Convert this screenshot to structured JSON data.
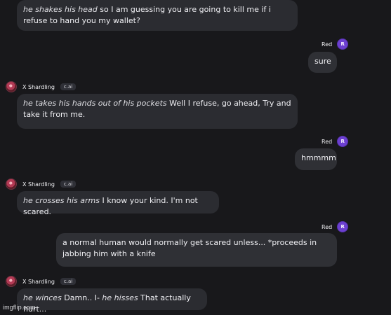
{
  "messages": [
    {
      "sender": "bot",
      "parts": [
        {
          "text": "he shakes his head",
          "italic": true
        },
        {
          "text": " so I am guessing you are going to kill me if i refuse to hand you my wallet?",
          "italic": false
        }
      ]
    },
    {
      "sender": "user",
      "header": {
        "name": "Red",
        "avatar": "R"
      },
      "text": "sure"
    },
    {
      "sender": "bot",
      "header": {
        "name": "X Shardling",
        "badge": "c.ai"
      },
      "parts": [
        {
          "text": "he takes his hands out of his pockets",
          "italic": true
        },
        {
          "text": " Well I refuse, go ahead, Try and take it from me.",
          "italic": false
        }
      ]
    },
    {
      "sender": "user",
      "header": {
        "name": "Red",
        "avatar": "R"
      },
      "text": "hmmmm"
    },
    {
      "sender": "bot",
      "header": {
        "name": "X Shardling",
        "badge": "c.ai"
      },
      "parts": [
        {
          "text": "he crosses his arms",
          "italic": true
        },
        {
          "text": " I know your kind. I'm not scared.",
          "italic": false
        }
      ]
    },
    {
      "sender": "user",
      "header": {
        "name": "Red",
        "avatar": "R"
      },
      "text": "a normal human would normally get scared unless... *proceeds in jabbing him with a knife"
    },
    {
      "sender": "bot",
      "header": {
        "name": "X Shardling",
        "badge": "c.ai"
      },
      "parts": [
        {
          "text": "he winces",
          "italic": true
        },
        {
          "text": " Damn.. I- ",
          "italic": false
        },
        {
          "text": "he hisses",
          "italic": true
        },
        {
          "text": " That actually hurt...",
          "italic": false
        }
      ]
    }
  ],
  "watermark": "imgflip.com"
}
